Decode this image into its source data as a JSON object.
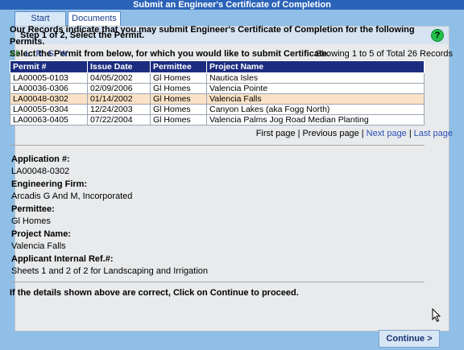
{
  "window": {
    "title": "Submit an Engineer's Certificate of Completion"
  },
  "tabs": [
    {
      "label": "Start"
    },
    {
      "label": "Documents"
    }
  ],
  "step": {
    "title": "Step 1 of 2, Select the Permit.",
    "help_glyph": "?"
  },
  "intro": {
    "line1": "Our Records indicate that you may submit Engineer's Certificate of Completion for the following Permits.",
    "line2": "Select the Permit from below, for which you would like to submit Certificate."
  },
  "filter": {
    "all": "All",
    "l": "L",
    "r": "R",
    "s": "S",
    "w": "W"
  },
  "showing": "Showing 1 to 5 of Total 26 Records",
  "table": {
    "headers": [
      "Permit #",
      "Issue Date",
      "Permittee",
      "Project Name"
    ],
    "rows": [
      [
        "LA00005-0103",
        "04/05/2002",
        "Gl Homes",
        "Nautica Isles"
      ],
      [
        "LA00036-0306",
        "02/09/2006",
        "Gl Homes",
        "Valencia Pointe"
      ],
      [
        "LA00048-0302",
        "01/14/2002",
        "Gl Homes",
        "Valencia Falls"
      ],
      [
        "LA00055-0304",
        "12/24/2003",
        "Gl Homes",
        "Canyon Lakes (aka Fogg North)"
      ],
      [
        "LA00063-0405",
        "07/22/2004",
        "Gl Homes",
        "Valencia Palms Jog Road Median Planting"
      ]
    ],
    "selected_row": 2
  },
  "pager": {
    "first": "First page",
    "previous": "Previous page",
    "next": "Next page",
    "last": "Last page",
    "separator": "|"
  },
  "details": {
    "application_label": "Application #:",
    "application_value": "LA00048-0302",
    "firm_label": "Engineering Firm:",
    "firm_value": "Arcadis G And M, Incorporated",
    "permittee_label": "Permittee:",
    "permittee_value": "Gl Homes",
    "project_label": "Project Name:",
    "project_value": "Valencia Falls",
    "ref_label": "Applicant Internal Ref.#:",
    "ref_value": "Sheets 1 and 2 of 2 for Landscaping and Irrigation"
  },
  "confirm_text": "If the details shown above are correct, Click on Continue to proceed.",
  "continue_label": "Continue  >",
  "colors": {
    "title_bar": "#2a63b8",
    "table_header": "#1c2d80",
    "selected_row": "#fbe2c6",
    "help_icon": "#22c04a"
  }
}
